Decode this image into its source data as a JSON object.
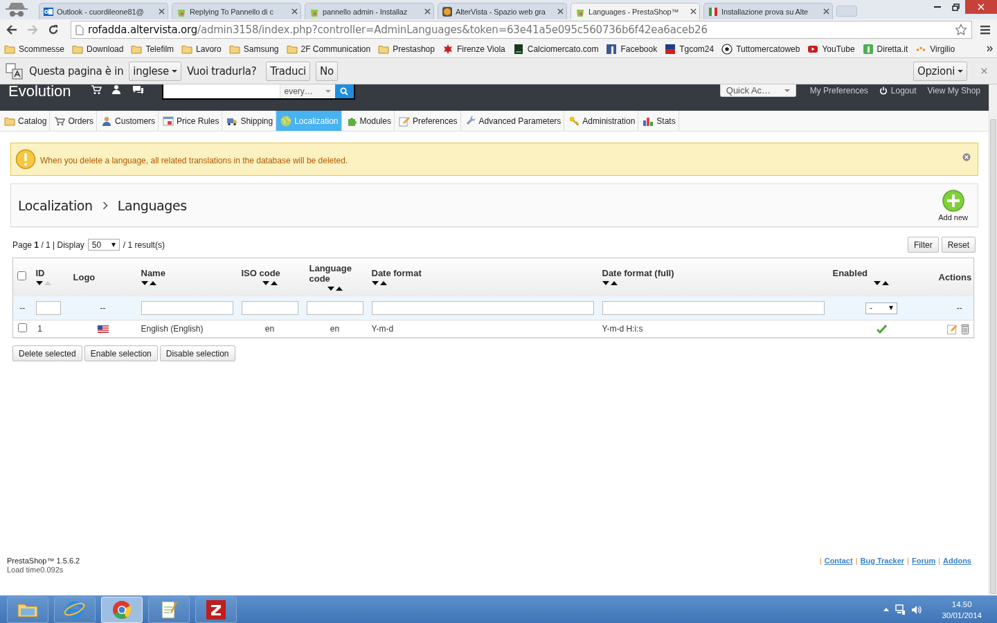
{
  "browser": {
    "tabs": [
      {
        "title": "Outlook - cuordileone81@",
        "kind": "outlook",
        "selected": false
      },
      {
        "title": "Replying To Pannello di c",
        "kind": "shop",
        "selected": false
      },
      {
        "title": "pannello admin - Installaz",
        "kind": "shop",
        "selected": false
      },
      {
        "title": "AlterVista - Spazio web gra",
        "kind": "altervista",
        "selected": false
      },
      {
        "title": "Languages - PrestaShop™",
        "kind": "shop",
        "selected": true
      },
      {
        "title": "Installazione prova su Alte",
        "kind": "flag",
        "selected": false
      }
    ],
    "address": {
      "host": "rofadda.altervista.org",
      "path": "/admin3158/index.php?controller=AdminLanguages&token=63e41a5e095c560736b6f42ea6aceb26"
    },
    "bookmarks": [
      {
        "label": "Scommesse",
        "kind": "folder"
      },
      {
        "label": "Download",
        "kind": "folder"
      },
      {
        "label": "Telefilm",
        "kind": "folder"
      },
      {
        "label": "Lavoro",
        "kind": "folder"
      },
      {
        "label": "Samsung",
        "kind": "folder"
      },
      {
        "label": "2F Communication",
        "kind": "folder"
      },
      {
        "label": "Prestashop",
        "kind": "folder"
      },
      {
        "label": "Firenze Viola",
        "kind": "emblem"
      },
      {
        "label": "Calciomercato.com",
        "kind": "dark"
      },
      {
        "label": "Facebook",
        "kind": "blue"
      },
      {
        "label": "Tgcom24",
        "kind": "news"
      },
      {
        "label": "Tuttomercatoweb",
        "kind": "ball"
      },
      {
        "label": "YouTube",
        "kind": "play"
      },
      {
        "label": "Diretta.it",
        "kind": "green"
      },
      {
        "label": "Virgilio",
        "kind": "dots"
      }
    ]
  },
  "translate_bar": {
    "prefix": "Questa pagina è in",
    "language": "inglese",
    "question": "Vuoi tradurla?",
    "buttons": [
      "Traduci",
      "No"
    ],
    "options": "Opzioni"
  },
  "admin_header": {
    "shop_name": "Evolution",
    "search_scope": "every…",
    "quick_access": "Quick Ac…",
    "links": [
      {
        "label": "My Preferences",
        "kind": "text"
      },
      {
        "label": "Logout",
        "kind": "power"
      },
      {
        "label": "View My Shop",
        "kind": "text"
      }
    ]
  },
  "menu": [
    {
      "label": "Catalog",
      "kind": "folder",
      "selected": false
    },
    {
      "label": "Orders",
      "kind": "cart",
      "selected": false
    },
    {
      "label": "Customers",
      "kind": "person",
      "selected": false
    },
    {
      "label": "Price Rules",
      "kind": "card",
      "selected": false
    },
    {
      "label": "Shipping",
      "kind": "truck",
      "selected": false
    },
    {
      "label": "Localization",
      "kind": "globe",
      "selected": true
    },
    {
      "label": "Modules",
      "kind": "puzzle",
      "selected": false
    },
    {
      "label": "Preferences",
      "kind": "pencil",
      "selected": false
    },
    {
      "label": "Advanced Parameters",
      "kind": "wrench",
      "selected": false
    },
    {
      "label": "Administration",
      "kind": "key",
      "selected": false
    },
    {
      "label": "Stats",
      "kind": "chart",
      "selected": false
    }
  ],
  "alert": {
    "text": "When you delete a language, all related translations in the database will be deleted."
  },
  "breadcrumb": [
    "Localization",
    "Languages"
  ],
  "add_new": "Add new",
  "list": {
    "page_info": "Page **1** / 1 | Display",
    "per_page": "50",
    "results": "/ 1 result(s)",
    "buttons": [
      "Filter",
      "Reset"
    ]
  },
  "table": {
    "select_all": false,
    "columns": [
      {
        "label": "ID",
        "sortable": true,
        "sorted_ascending": true
      },
      {
        "label": "Logo",
        "sortable": false
      },
      {
        "label": "Name",
        "sortable": true,
        "sorted_ascending": false
      },
      {
        "label": "ISO code",
        "sortable": true,
        "sorted_ascending": false
      },
      {
        "label": "Language code",
        "sortable": true,
        "sorted_ascending": false
      },
      {
        "label": "Date format",
        "sortable": true,
        "sorted_ascending": false
      },
      {
        "label": "Date format (full)",
        "sortable": true,
        "sorted_ascending": false
      },
      {
        "label": "Enabled",
        "sortable": true,
        "sorted_ascending": false
      },
      {
        "label": "Actions",
        "sortable": false
      }
    ],
    "filters": {
      "checkbox_column": "--",
      "logo": "--",
      "enabled": "-",
      "actions": "--"
    },
    "rows": [
      {
        "selected": false,
        "id": "1",
        "name": "English (English)",
        "iso_code": "en",
        "language_code": "en",
        "date_format": "Y-m-d",
        "date_format_full": "Y-m-d H:i:s",
        "enabled": true
      }
    ]
  },
  "bulk_actions": [
    "Delete selected",
    "Enable selection",
    "Disable selection"
  ],
  "footer": {
    "version": "PrestaShop™ 1.5.6.2",
    "load_time": "Load time0.092s",
    "separator": "|",
    "links": [
      "Contact",
      "Bug Tracker",
      "Forum",
      "Addons"
    ]
  },
  "taskbar": {
    "apps": [
      {
        "kind": "explorer",
        "selected": false
      },
      {
        "kind": "ie",
        "selected": false
      },
      {
        "kind": "chrome",
        "selected": true
      },
      {
        "kind": "notepad",
        "selected": false
      },
      {
        "kind": "filezilla",
        "selected": false
      }
    ],
    "time": "14.50",
    "date": "30/01/2014"
  }
}
